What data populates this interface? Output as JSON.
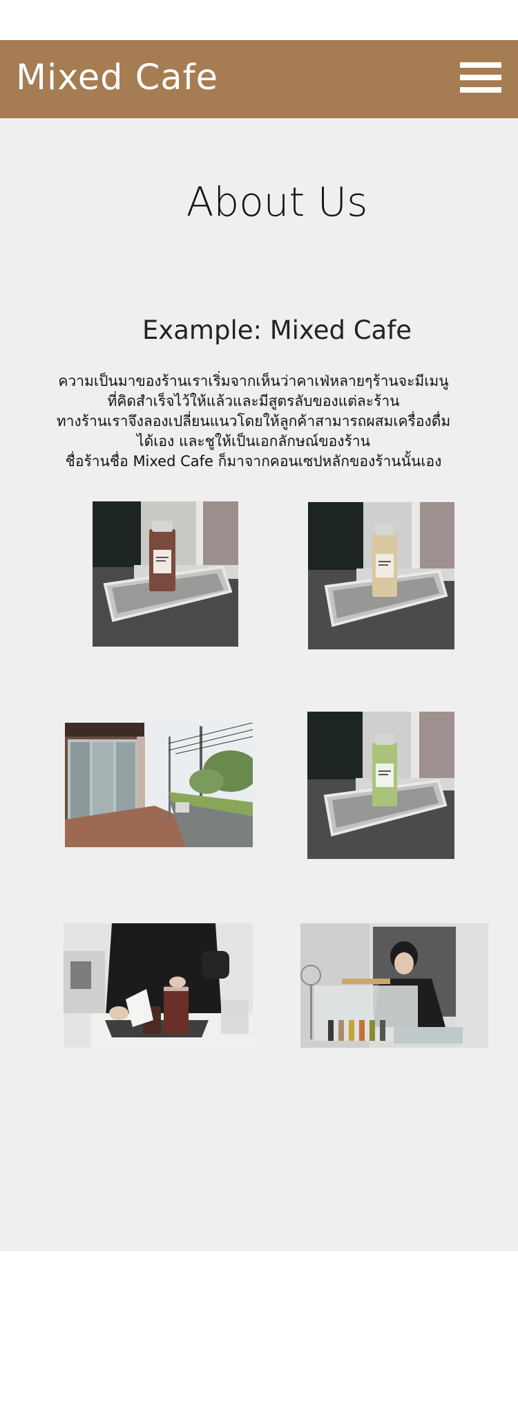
{
  "header": {
    "brand": "Mixed Cafe",
    "menu_icon": "hamburger-menu-icon",
    "background_color": "#a67c52"
  },
  "main": {
    "title": "About Us",
    "subtitle": "Example: Mixed Cafe",
    "description_lines": [
      "ความเป็นมาของร้านเราเริ่มจากเห็นว่าคาเฟ่หลายๆร้านจะมีเมนู",
      "ที่คิดสำเร็จไว้ให้แล้วและมีสูตรลับของแต่ละร้าน",
      "ทางร้านเราจึงลองเปลี่ยนแนวโดยให้ลูกค้าสามารถผสมเครื่องดื่ม",
      "ได้เอง และชูให้เป็นเอกลักษณ์ของร้าน",
      "ชื่อร้านชื่อ Mixed Cafe ก็มาจากคอนเซปหลักของร้านนั้นเอง"
    ],
    "background_color": "#efefef"
  },
  "gallery": [
    {
      "name": "bottle-dark-on-tray-photo"
    },
    {
      "name": "bottle-cream-on-tray-photo"
    },
    {
      "name": "cafe-storefront-photo"
    },
    {
      "name": "bottle-green-on-tray-photo"
    },
    {
      "name": "barista-preparing-drinks-photo"
    },
    {
      "name": "barista-at-counter-photo"
    }
  ]
}
